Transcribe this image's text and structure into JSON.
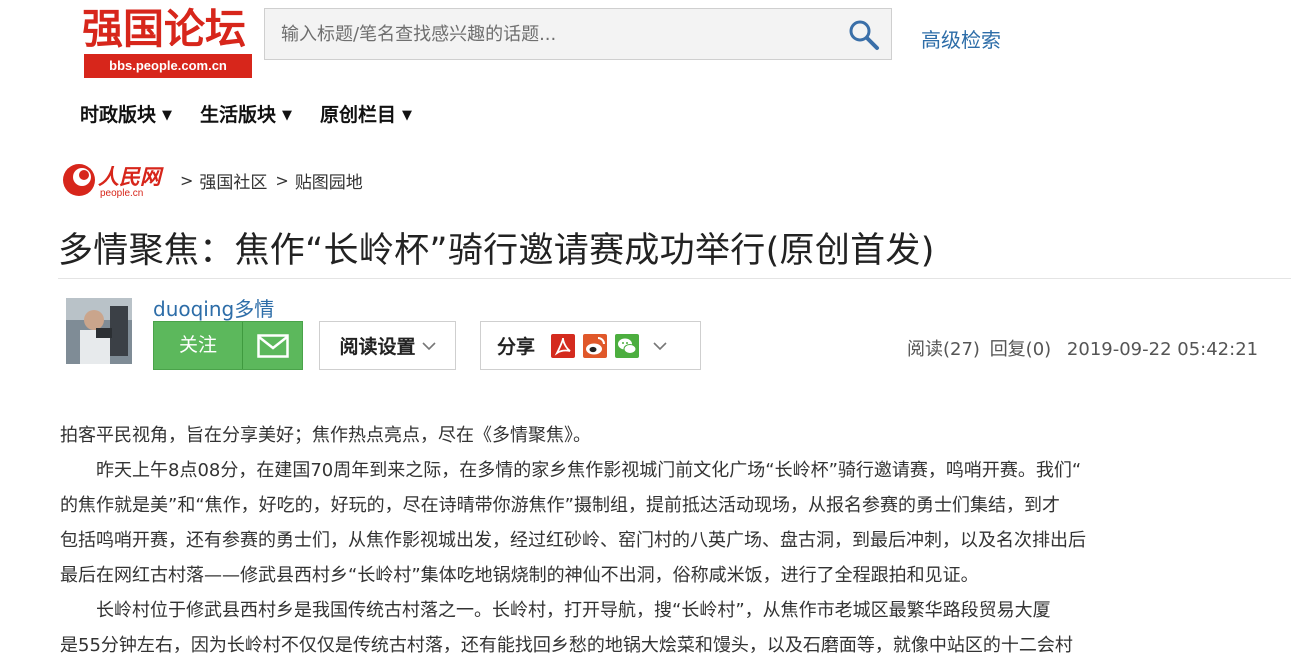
{
  "site": {
    "logo_title": "强国论坛",
    "logo_url": "bbs.people.com.cn"
  },
  "search": {
    "placeholder": "输入标题/笔名查找感兴趣的话题...",
    "value": "",
    "advanced_label": "高级检索"
  },
  "nav": {
    "items": [
      {
        "label": "时政版块"
      },
      {
        "label": "生活版块"
      },
      {
        "label": "原创栏目"
      }
    ]
  },
  "breadcrumb": {
    "brand_name": "人民网",
    "brand_url": "people.cn",
    "items": [
      {
        "label": "强国社区"
      },
      {
        "label": "贴图园地"
      }
    ]
  },
  "post": {
    "title": "多情聚焦：焦作“长岭杯”骑行邀请赛成功举行(原创首发)",
    "author": "duoqing多情",
    "follow_label": "关注",
    "read_settings_label": "阅读设置",
    "share_label": "分享",
    "reads": "阅读(27)",
    "replies": "回复(0)",
    "datetime": "2019-09-22 05:42:21"
  },
  "article": {
    "lines": [
      "拍客平民视角，旨在分享美好；焦作热点亮点，尽在《多情聚焦》。",
      "　　昨天上午8点08分，在建国70周年到来之际，在多情的家乡焦作影视城门前文化广场“长岭杯”骑行邀请赛，鸣哨开赛。我们“",
      "的焦作就是美”和“焦作，好吃的，好玩的，尽在诗晴带你游焦作”摄制组，提前抵达活动现场，从报名参赛的勇士们集结，到才",
      "包括鸣哨开赛，还有参赛的勇士们，从焦作影视城出发，经过红砂岭、窑门村的八英广场、盘古洞，到最后冲刺，以及名次排出后",
      "最后在网红古村落——修武县西村乡“长岭村”集体吃地锅烧制的神仙不出洞，俗称咸米饭，进行了全程跟拍和见证。",
      "　　长岭村位于修武县西村乡是我国传统古村落之一。长岭村，打开导航，搜“长岭村”，从焦作市老城区最繁华路段贸易大厦",
      "是55分钟左右，因为长岭村不仅仅是传统古村落，还有能找回乡愁的地锅大烩菜和馒头，以及石磨面等，就像中站区的十二会村"
    ]
  },
  "icons": {
    "search": "search-icon",
    "mail": "mail-icon",
    "chevron": "chevron-down-icon",
    "share_targets": [
      "adobe-icon",
      "weibo-icon",
      "wechat-icon"
    ]
  },
  "colors": {
    "brand_red": "#d7261b",
    "link_blue": "#2d6da8",
    "follow_green": "#5cb85c"
  }
}
